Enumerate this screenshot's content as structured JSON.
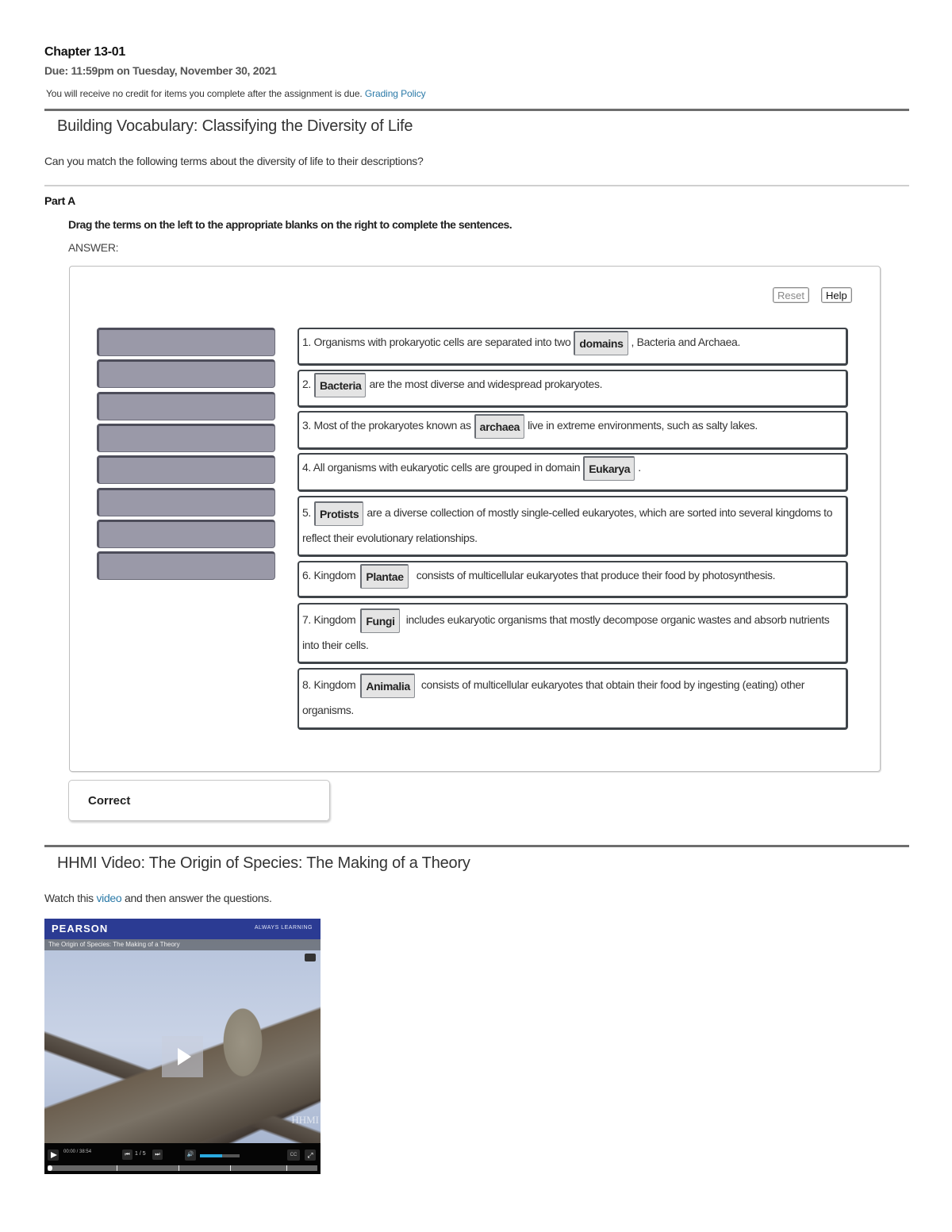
{
  "assignment": {
    "title": "Chapter 13-01",
    "due": "Due: 11:59pm on Tuesday, November 30, 2021",
    "notice": "You will receive no credit for items you complete after the assignment is due.",
    "grading_policy_link": "Grading Policy"
  },
  "item1": {
    "title": "Building Vocabulary: Classifying the Diversity of Life",
    "intro": "Can you match the following terms about the diversity of life to their descriptions?",
    "part_label": "Part A",
    "instructions": "Drag the terms on the left to the appropriate blanks on the right to complete the sentences.",
    "answer_label": "ANSWER:",
    "buttons": {
      "reset": "Reset",
      "help": "Help"
    },
    "source_slots_count": 8,
    "sentences": [
      {
        "before": "1. Organisms with prokaryotic cells are separated into two",
        "term": "domains",
        "after": ", Bacteria and Archaea."
      },
      {
        "before": "2.",
        "term": "Bacteria",
        "after": "are the most diverse and widespread prokaryotes."
      },
      {
        "before": "3. Most of the prokaryotes known as",
        "term": "archaea",
        "after": "live in extreme environments, such as salty lakes."
      },
      {
        "before": "4. All organisms with eukaryotic cells are grouped in domain",
        "term": "Eukarya",
        "after": "."
      },
      {
        "before": "5.",
        "term": "Protists",
        "after": "are a diverse collection of mostly single-celled eukaryotes, which are sorted into several kingdoms to reflect their evolutionary relationships."
      },
      {
        "before": "6. Kingdom",
        "term": "Plantae",
        "after": "consists of multicellular eukaryotes that produce their food by photosynthesis."
      },
      {
        "before": "7. Kingdom",
        "term": "Fungi",
        "after": "includes eukaryotic organisms that mostly decompose organic wastes and absorb nutrients into their cells."
      },
      {
        "before": "8. Kingdom",
        "term": "Animalia",
        "after": "consists of multicellular eukaryotes that obtain their food by ingesting (eating) other organisms."
      }
    ],
    "feedback": "Correct"
  },
  "item2": {
    "title": "HHMI Video: The Origin of Species: The Making of a Theory",
    "watch_before": "Watch this",
    "watch_link": "video",
    "watch_after": "and then answer the questions.",
    "video": {
      "brand": "PEARSON",
      "tagline": "ALWAYS LEARNING",
      "caption": "The Origin of Species: The Making of a Theory",
      "watermark": "HHMI",
      "time": "00:00 / 38:54",
      "chapter": "1 / 5",
      "volume_fraction": 0.55,
      "progress_fraction": 0.0,
      "cc_label": "CC",
      "icons": {
        "play": "play-icon",
        "prev": "skip-back-icon",
        "next": "skip-forward-icon",
        "volume": "speaker-icon",
        "fullscreen": "expand-icon"
      }
    }
  }
}
